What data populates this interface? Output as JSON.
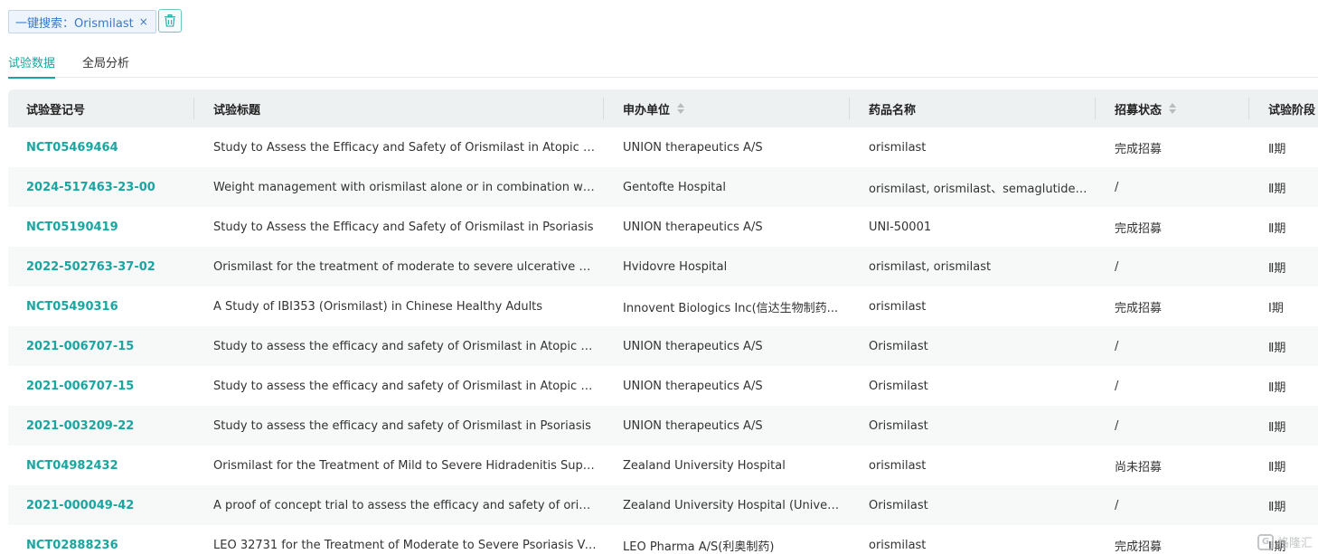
{
  "search_tag": {
    "label": "一键搜索：Orismilast",
    "close": "×"
  },
  "tabs": [
    {
      "label": "试验数据",
      "active": true
    },
    {
      "label": "全局分析",
      "active": false
    }
  ],
  "colors": {
    "accent": "#1aa6a0",
    "tag_text": "#3b79c8",
    "header_bg": "#eef1f2"
  },
  "table": {
    "columns": [
      {
        "label": "试验登记号",
        "sortable": false
      },
      {
        "label": "试验标题",
        "sortable": false
      },
      {
        "label": "申办单位",
        "sortable": true
      },
      {
        "label": "药品名称",
        "sortable": false
      },
      {
        "label": "招募状态",
        "sortable": true
      },
      {
        "label": "试验阶段",
        "sortable": false
      }
    ],
    "rows": [
      [
        "NCT05469464",
        "Study to Assess the Efficacy and Safety of Orismilast in Atopic Der...",
        "UNION therapeutics A/S",
        "orismilast",
        "完成招募",
        "Ⅱ期"
      ],
      [
        "2024-517463-23-00",
        "Weight management with orismilast alone or in combination with...",
        "Gentofte Hospital",
        "orismilast, orismilast、semaglutide、...",
        "/",
        "Ⅱ期"
      ],
      [
        "NCT05190419",
        "Study to Assess the Efficacy and Safety of Orismilast in Psoriasis",
        "UNION therapeutics A/S",
        "UNI-50001",
        "完成招募",
        "Ⅱ期"
      ],
      [
        "2022-502763-37-02",
        "Orismilast for the treatment of moderate to severe ulcerative colitis",
        "Hvidovre Hospital",
        "orismilast, orismilast",
        "/",
        "Ⅱ期"
      ],
      [
        "NCT05490316",
        "A Study of IBI353 (Orismilast) in Chinese Healthy Adults",
        "Innovent Biologics Inc(信达生物制药...",
        "orismilast",
        "完成招募",
        "Ⅰ期"
      ],
      [
        "2021-006707-15",
        "Study to assess the efficacy and safety of Orismilast in Atopic Der...",
        "UNION therapeutics A/S",
        "Orismilast",
        "/",
        "Ⅱ期"
      ],
      [
        "2021-006707-15",
        "Study to assess the efficacy and safety of Orismilast in Atopic Der...",
        "UNION therapeutics A/S",
        "Orismilast",
        "/",
        "Ⅱ期"
      ],
      [
        "2021-003209-22",
        "Study to assess the efficacy and safety of Orismilast in Psoriasis",
        "UNION therapeutics A/S",
        "Orismilast",
        "/",
        "Ⅱ期"
      ],
      [
        "NCT04982432",
        "Orismilast for the Treatment of Mild to Severe Hidradenitis Suppu...",
        "Zealand University Hospital",
        "orismilast",
        "尚未招募",
        "Ⅱ期"
      ],
      [
        "2021-000049-42",
        "A proof of concept trial to assess the efficacy and safety of orismil...",
        "Zealand University Hospital (Universi...",
        "Orismilast",
        "/",
        "Ⅱ期"
      ],
      [
        "NCT02888236",
        "LEO 32731 for the Treatment of Moderate to Severe Psoriasis Vul...",
        "LEO Pharma A/S(利奥制药)",
        "orismilast",
        "完成招募",
        "Ⅱ期"
      ]
    ]
  },
  "watermark": {
    "text": "格隆汇"
  }
}
